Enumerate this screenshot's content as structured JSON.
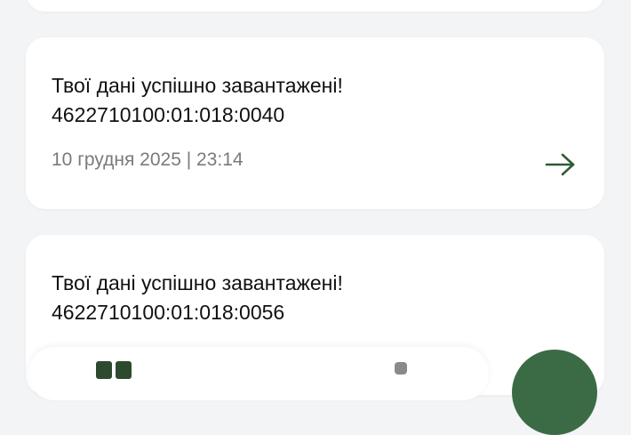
{
  "notifications": [
    {
      "title": "Твої дані успішно завантажені!",
      "code": "4622710100:01:018:0040",
      "date": "10 грудня 2025 | 23:14"
    },
    {
      "title": "Твої дані успішно завантажені!",
      "code": "4622710100:01:018:0056"
    }
  ],
  "icons": {
    "arrow": "arrow-right-icon",
    "nav_left": "grid-icon",
    "nav_right": "nav-icon",
    "fab": "action-button"
  },
  "colors": {
    "background": "#f3f4f6",
    "card": "#ffffff",
    "text": "#111111",
    "muted": "#7a7a7a",
    "accent": "#2f5b35",
    "fab": "#3a6b45"
  }
}
